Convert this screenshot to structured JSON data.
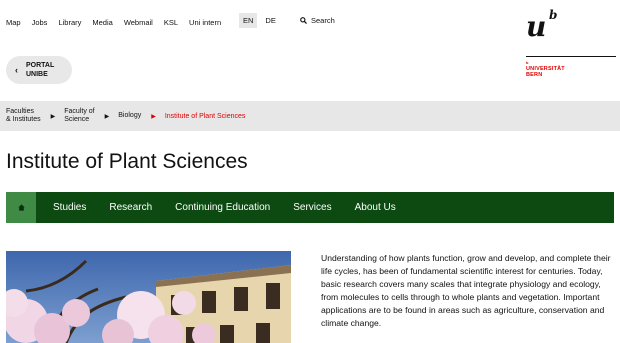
{
  "topnav": {
    "items": [
      "Map",
      "Jobs",
      "Library",
      "Media",
      "Webmail",
      "KSL",
      "Uni intern"
    ]
  },
  "language": {
    "options": [
      "EN",
      "DE"
    ],
    "active": "EN"
  },
  "search": {
    "label": "Search",
    "icon": "magnifier"
  },
  "logo": {
    "mark_u": "u",
    "mark_b": "b",
    "small_b": "b",
    "line1": "UNIVERSITÄT",
    "line2": "BERN"
  },
  "portal": {
    "line1": "PORTAL",
    "line2": "UNIBE",
    "icon": "chevron-left"
  },
  "breadcrumb": {
    "items": [
      {
        "line1": "Faculties",
        "line2": "& Institutes"
      },
      {
        "line1": "Faculty of",
        "line2": "Science"
      },
      {
        "line1": "Biology",
        "line2": ""
      }
    ],
    "current": "Institute of Plant Sciences"
  },
  "page": {
    "title": "Institute of Plant Sciences"
  },
  "mainnav": {
    "home_icon": "home",
    "items": [
      "Studies",
      "Research",
      "Continuing Education",
      "Services",
      "About Us"
    ]
  },
  "intro": {
    "text": "Understanding of how plants function, grow and develop, and complete their life cycles, has been of fundamental scientific interest for centuries. Today, basic research covers many scales that integrate physiology and ecology, from molecules to cells through to whole plants and vegetation. Important applications are to be found in areas such as agriculture, conservation and climate change."
  },
  "colors": {
    "nav_green": "#0c4a12",
    "home_green": "#3f8a44",
    "accent_red": "#e00000",
    "crumb_bg": "#e7e7e7"
  }
}
